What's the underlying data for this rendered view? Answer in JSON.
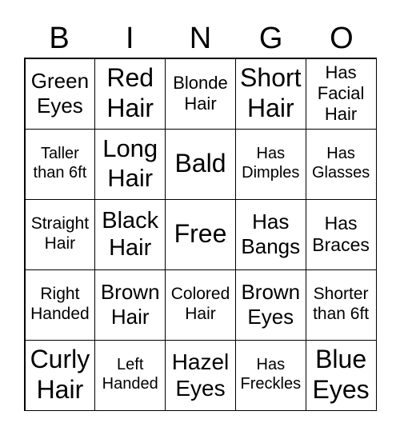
{
  "header": [
    "B",
    "I",
    "N",
    "G",
    "O"
  ],
  "cells": [
    [
      "Green Eyes",
      "Red Hair",
      "Blonde Hair",
      "Short Hair",
      "Has Facial Hair"
    ],
    [
      "Taller than 6ft",
      "Long Hair",
      "Bald",
      "Has Dimples",
      "Has Glasses"
    ],
    [
      "Straight Hair",
      "Black Hair",
      "Free",
      "Has Bangs",
      "Has Braces"
    ],
    [
      "Right Handed",
      "Brown Hair",
      "Colored Hair",
      "Brown Eyes",
      "Shorter than 6ft"
    ],
    [
      "Curly Hair",
      "Left Handed",
      "Hazel Eyes",
      "Has Freckles",
      "Blue Eyes"
    ]
  ]
}
